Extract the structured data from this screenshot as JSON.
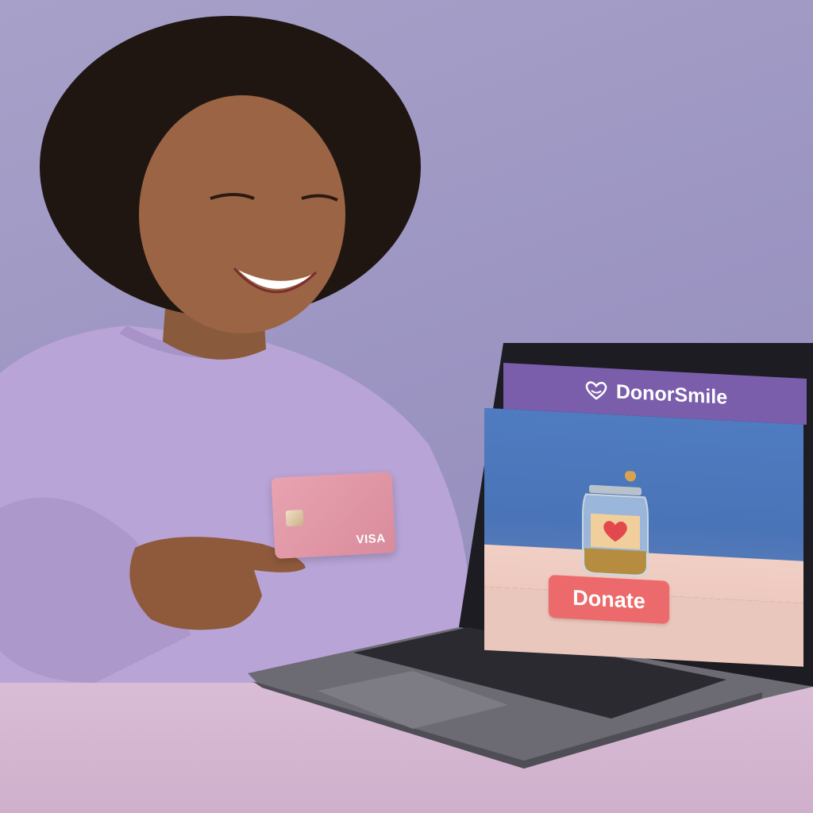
{
  "site": {
    "brand": "DonorSmile",
    "logo_icon": "heart-smile-icon",
    "brand_color": "#7a5dab",
    "hero_icon": "heart-jar-icon"
  },
  "cta": {
    "label": "Donate",
    "color": "#ec6a6b"
  },
  "card": {
    "brand": "VISA",
    "color": "#e09aa8"
  },
  "scene": {
    "background_color": "#9c95c2",
    "desk_color": "#d6b8d3"
  }
}
